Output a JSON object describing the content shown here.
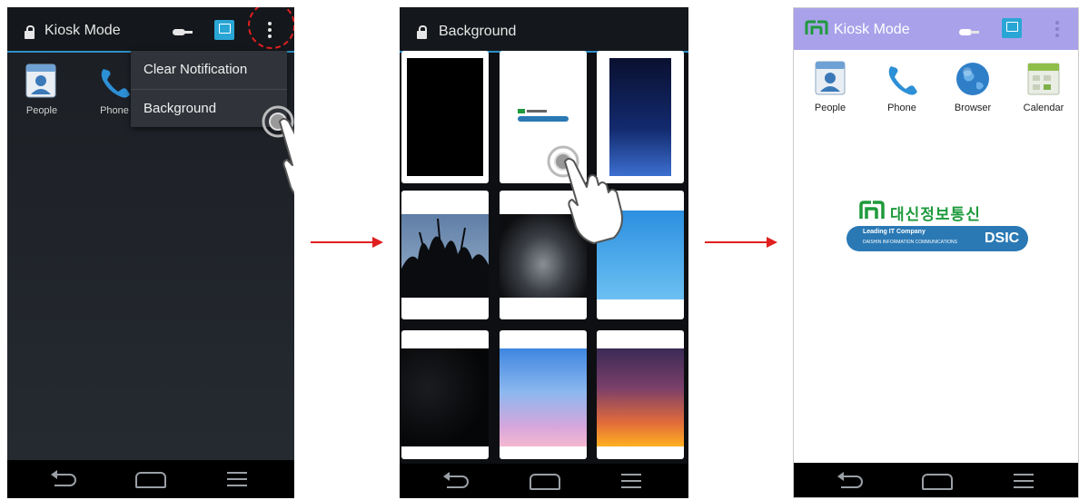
{
  "panel1": {
    "title": "Kiosk Mode",
    "apps": [
      {
        "label": "People",
        "icon": "contacts-icon"
      },
      {
        "label": "Phone",
        "icon": "phone-icon"
      }
    ],
    "menu": {
      "items": [
        "Clear Notification",
        "Background"
      ],
      "highlighted": "Background"
    },
    "icons": [
      "lock-icon",
      "key-icon",
      "kiosk-icon",
      "overflow-menu-icon"
    ]
  },
  "panel2": {
    "title": "Background",
    "thumbnails": [
      "black",
      "dsic-logo",
      "night-blue",
      "tree-silhouette",
      "dark-swoosh",
      "sky-blue",
      "starfield",
      "pink-gradient",
      "sunset-gradient"
    ]
  },
  "panel3": {
    "title": "Kiosk Mode",
    "apps": [
      {
        "label": "People",
        "icon": "contacts-icon"
      },
      {
        "label": "Phone",
        "icon": "phone-icon"
      },
      {
        "label": "Browser",
        "icon": "globe-icon"
      },
      {
        "label": "Calendar",
        "icon": "calendar-icon"
      }
    ],
    "logo": {
      "korean": "대신정보통신",
      "tagline": "Leading IT Company",
      "subline": "DAISHIN INFORMATION COMMUNICATIONS",
      "brand": "DSIC"
    }
  },
  "colors": {
    "accent": "#2e8fc6",
    "arrow": "#e02020",
    "purple_bar": "#a9a2ea",
    "logo_green": "#1e9a3c",
    "logo_blue": "#2a79b5"
  }
}
